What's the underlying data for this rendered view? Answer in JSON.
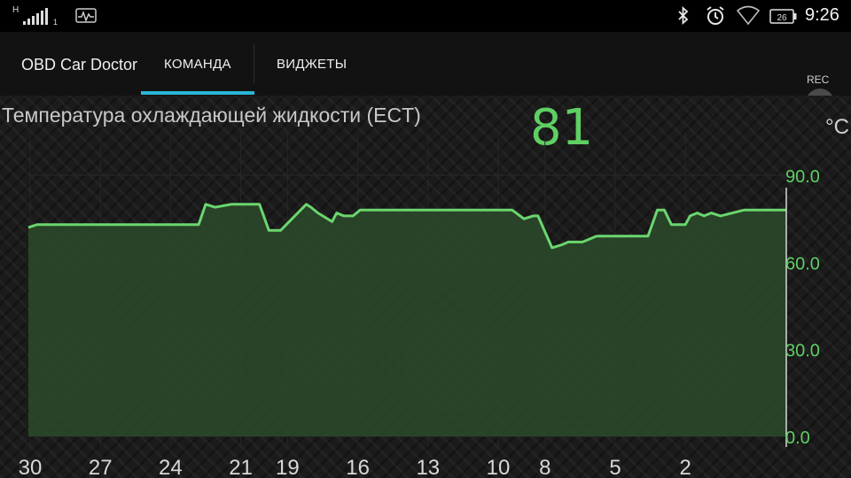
{
  "status_bar": {
    "network_type": "H",
    "sim_slot": "1",
    "battery_level": "26",
    "time": "9:26",
    "icons": [
      "signal-icon",
      "car-doctor-notification-icon",
      "bluetooth-icon",
      "alarm-icon",
      "wifi-icon",
      "battery-icon"
    ]
  },
  "app_bar": {
    "title": "OBD Car Doctor",
    "tabs": [
      {
        "label": "КОМАНДА",
        "selected": true
      },
      {
        "label": "ВИДЖЕТЫ",
        "selected": false
      }
    ],
    "rec_label": "REC",
    "accent_color": "#29b6d6"
  },
  "sensor": {
    "name": "Температура охлаждающей жидкости (ECT)",
    "value": "81",
    "unit": "°C",
    "value_color": "#5fcf63"
  },
  "chart_data": {
    "type": "area",
    "title": "",
    "xlabel": "",
    "ylabel": "",
    "x_tick_labels": [
      "30",
      "27",
      "24",
      "21",
      "19",
      "16",
      "13",
      "10",
      "8",
      "5",
      "2"
    ],
    "y_tick_labels": [
      "90.0",
      "60.0",
      "30.0",
      "0.0"
    ],
    "ylim": [
      0,
      90
    ],
    "x_direction": "descending seconds, 30 at left to 0 at right",
    "grid": true,
    "line_color": "#6ad66e",
    "fill_color": "#2a4a2a",
    "series": [
      {
        "x": [
          30.5,
          29.7,
          29.2,
          22.8,
          22.5,
          22.1,
          21.4,
          20.2,
          19.8,
          19.3,
          18.2,
          18.0,
          17.7,
          17.1,
          16.9,
          16.6,
          16.2,
          15.9,
          15.6,
          12.6,
          11.2,
          9.4,
          8.9,
          8.5,
          8.3,
          7.7,
          7.3,
          7.0,
          6.7,
          6.4,
          6.1,
          5.8,
          5.3,
          4.0,
          3.6,
          3.2,
          2.9,
          2.6,
          2.5,
          2.2,
          2.0,
          1.8,
          1.5,
          1.2,
          0.9,
          0.5,
          -0.5,
          -2.6
        ],
        "y": [
          72,
          73,
          73,
          73,
          80,
          79,
          80,
          80,
          71,
          71,
          80,
          79,
          77,
          74,
          77,
          76,
          76,
          78,
          78,
          78,
          78,
          78,
          75,
          76,
          76,
          65,
          66,
          67,
          67,
          67,
          68,
          69,
          69,
          69,
          69,
          78,
          78,
          73,
          73,
          73,
          73,
          76,
          77,
          76,
          77,
          76,
          78,
          78
        ]
      }
    ]
  }
}
